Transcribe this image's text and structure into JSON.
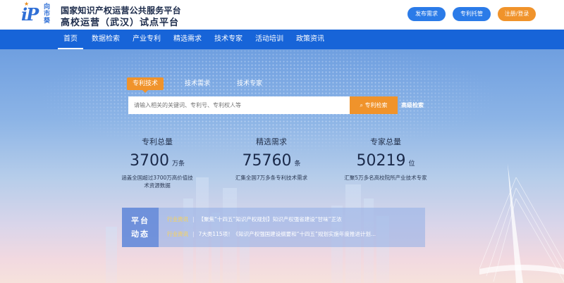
{
  "logo": {
    "mark": "iP",
    "cn_text": "向市葵"
  },
  "header": {
    "title_top": "国家知识产权运营公共服务平台",
    "title_bottom": "高校运营（武汉）试点平台",
    "buttons": [
      "发布需求",
      "专利托管",
      "注册/登录"
    ]
  },
  "nav": [
    "首页",
    "数据检索",
    "产业专利",
    "精选需求",
    "技术专家",
    "活动培训",
    "政策资讯"
  ],
  "search": {
    "tabs": [
      "专利技术",
      "技术需求",
      "技术专家"
    ],
    "placeholder": "请输入相关的关键词、专利号、专利权人等",
    "button": "专利检索",
    "advanced": "高级检索"
  },
  "stats": [
    {
      "label": "专利总量",
      "value": "3700",
      "unit": "万条",
      "desc": "涵盖全国超过3700万高价值技术资源数据"
    },
    {
      "label": "精选需求",
      "value": "75760",
      "unit": "条",
      "desc": "汇集全国7万多条专利技术需求"
    },
    {
      "label": "专家总量",
      "value": "50219",
      "unit": "位",
      "desc": "汇聚5万多名高校院所产业技术专家"
    }
  ],
  "dynamics": {
    "title_line1": "平台",
    "title_line2": "动态",
    "news": [
      {
        "tag": "行业资讯",
        "text": "【聚焦“十四五”知识产权规划】知识产权强省建设“甘味”正浓"
      },
      {
        "tag": "行业资讯",
        "text": "7大类115项！《知识产权强国建设纲要和“十四五”规划实施年度推进计划..."
      }
    ]
  },
  "colors": {
    "primary": "#1764d8",
    "accent": "#f0932b",
    "button_blue": "#2b7be8"
  }
}
